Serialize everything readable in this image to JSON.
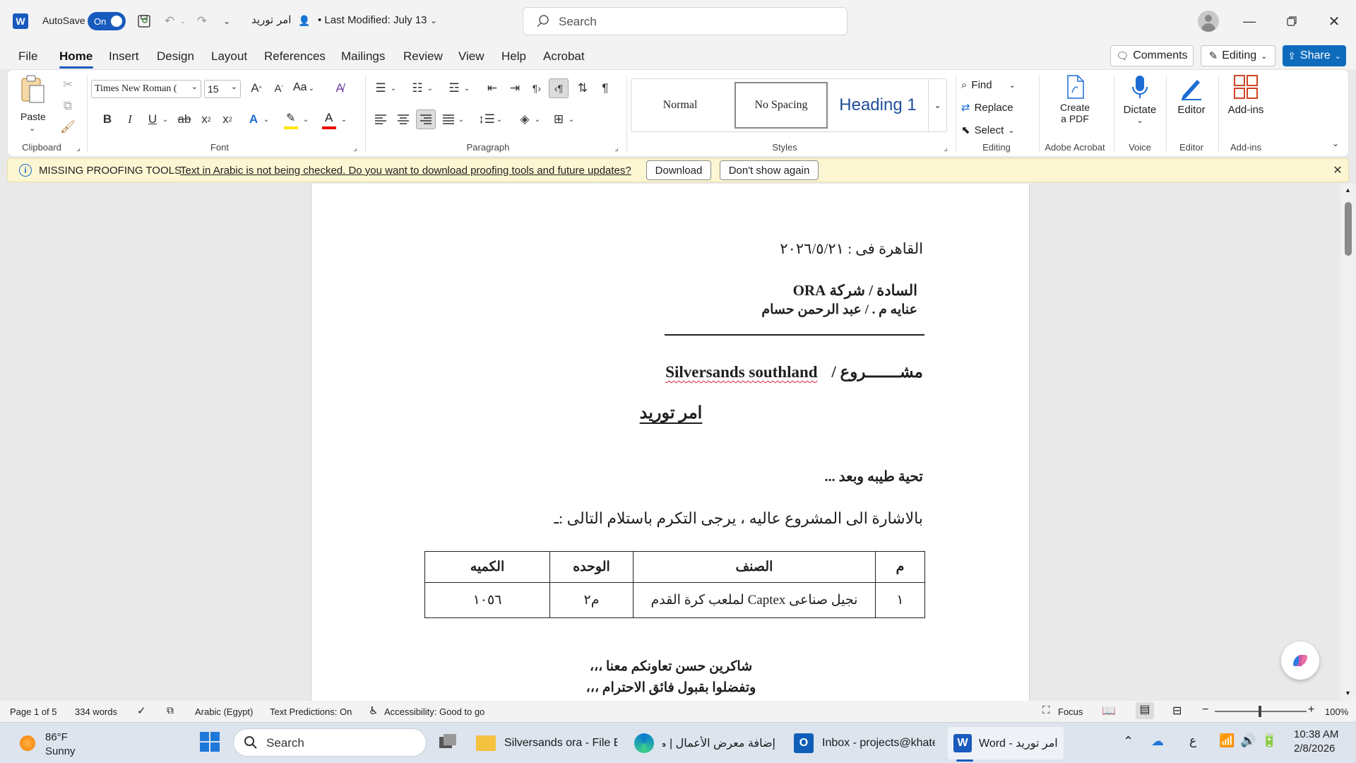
{
  "titlebar": {
    "autosave_label": "AutoSave",
    "autosave_state": "On",
    "doc_name": "امر توريد",
    "last_modified": "• Last Modified: July 13",
    "search_placeholder": "Search"
  },
  "tabs": [
    "File",
    "Home",
    "Insert",
    "Design",
    "Layout",
    "References",
    "Mailings",
    "Review",
    "View",
    "Help",
    "Acrobat"
  ],
  "right_buttons": {
    "comments": "Comments",
    "editing": "Editing",
    "share": "Share"
  },
  "ribbon": {
    "clipboard": {
      "paste": "Paste",
      "label": "Clipboard"
    },
    "font": {
      "name": "Times New Roman (",
      "size": "15",
      "label": "Font",
      "case": "Aa"
    },
    "paragraph": {
      "label": "Paragraph"
    },
    "styles": {
      "normal": "Normal",
      "nospacing": "No Spacing",
      "heading1": "Heading 1",
      "label": "Styles"
    },
    "editing": {
      "find": "Find",
      "replace": "Replace",
      "select": "Select",
      "label": "Editing"
    },
    "acrobat": {
      "create_line1": "Create",
      "create_line2": "a PDF",
      "label": "Adobe Acrobat"
    },
    "voice": {
      "dictate": "Dictate",
      "label": "Voice"
    },
    "editor": {
      "editor": "Editor",
      "label": "Editor"
    },
    "addins": {
      "addins": "Add-ins",
      "label": "Add-ins"
    }
  },
  "message": {
    "title": "MISSING PROOFING TOOLS",
    "text": "Text in Arabic is not being checked. Do you want to download proofing tools and future updates?",
    "download": "Download",
    "dont_show": "Don't show again"
  },
  "document": {
    "date_line": "القاهرة فى : ٢٠٢٦/٥/٢١",
    "to_line": "السادة / شركة ORA",
    "attn_line": "عنايه  م . / عبد الرحمن حسام",
    "project_label": "مشـــــــروع /",
    "project_name": "Silversands southland",
    "title": "امر توريد",
    "greeting": "تحية طيبه وبعد ...",
    "body": "بالاشارة الى المشروع عاليه ، يرجى التكرم باستلام التالى :ـ",
    "table": {
      "headers": [
        "م",
        "الصنف",
        "الوحده",
        "الكميه"
      ],
      "rows": [
        [
          "١",
          "نجيل صناعى Captex لملعب كرة القدم",
          "م٢",
          "١٠٥٦"
        ]
      ]
    },
    "closing1": "شاكرين حسن تعاونكم معنا ،،،",
    "closing2": "وتفضلوا بقبول فائق الاحترام ،،،"
  },
  "status": {
    "page": "Page 1 of 5",
    "words": "334 words",
    "language": "Arabic (Egypt)",
    "predictions": "Text Predictions: On",
    "accessibility": "Accessibility: Good to go",
    "focus": "Focus",
    "zoom": "100%"
  },
  "taskbar": {
    "weather_temp": "86°F",
    "weather_desc": "Sunny",
    "search": "Search",
    "explorer": "Silversands ora - File Ex",
    "edge": "إضافة معرض الأعمال | مس",
    "outlook": "Inbox - projects@khater",
    "word": "Word - امر توريد",
    "ime": "ع",
    "time": "10:38 AM",
    "date": "2/8/2026"
  },
  "colors": {
    "accent": "#185abd",
    "share_bg": "#0f6cbd",
    "message_bg": "#fdf6d3"
  }
}
